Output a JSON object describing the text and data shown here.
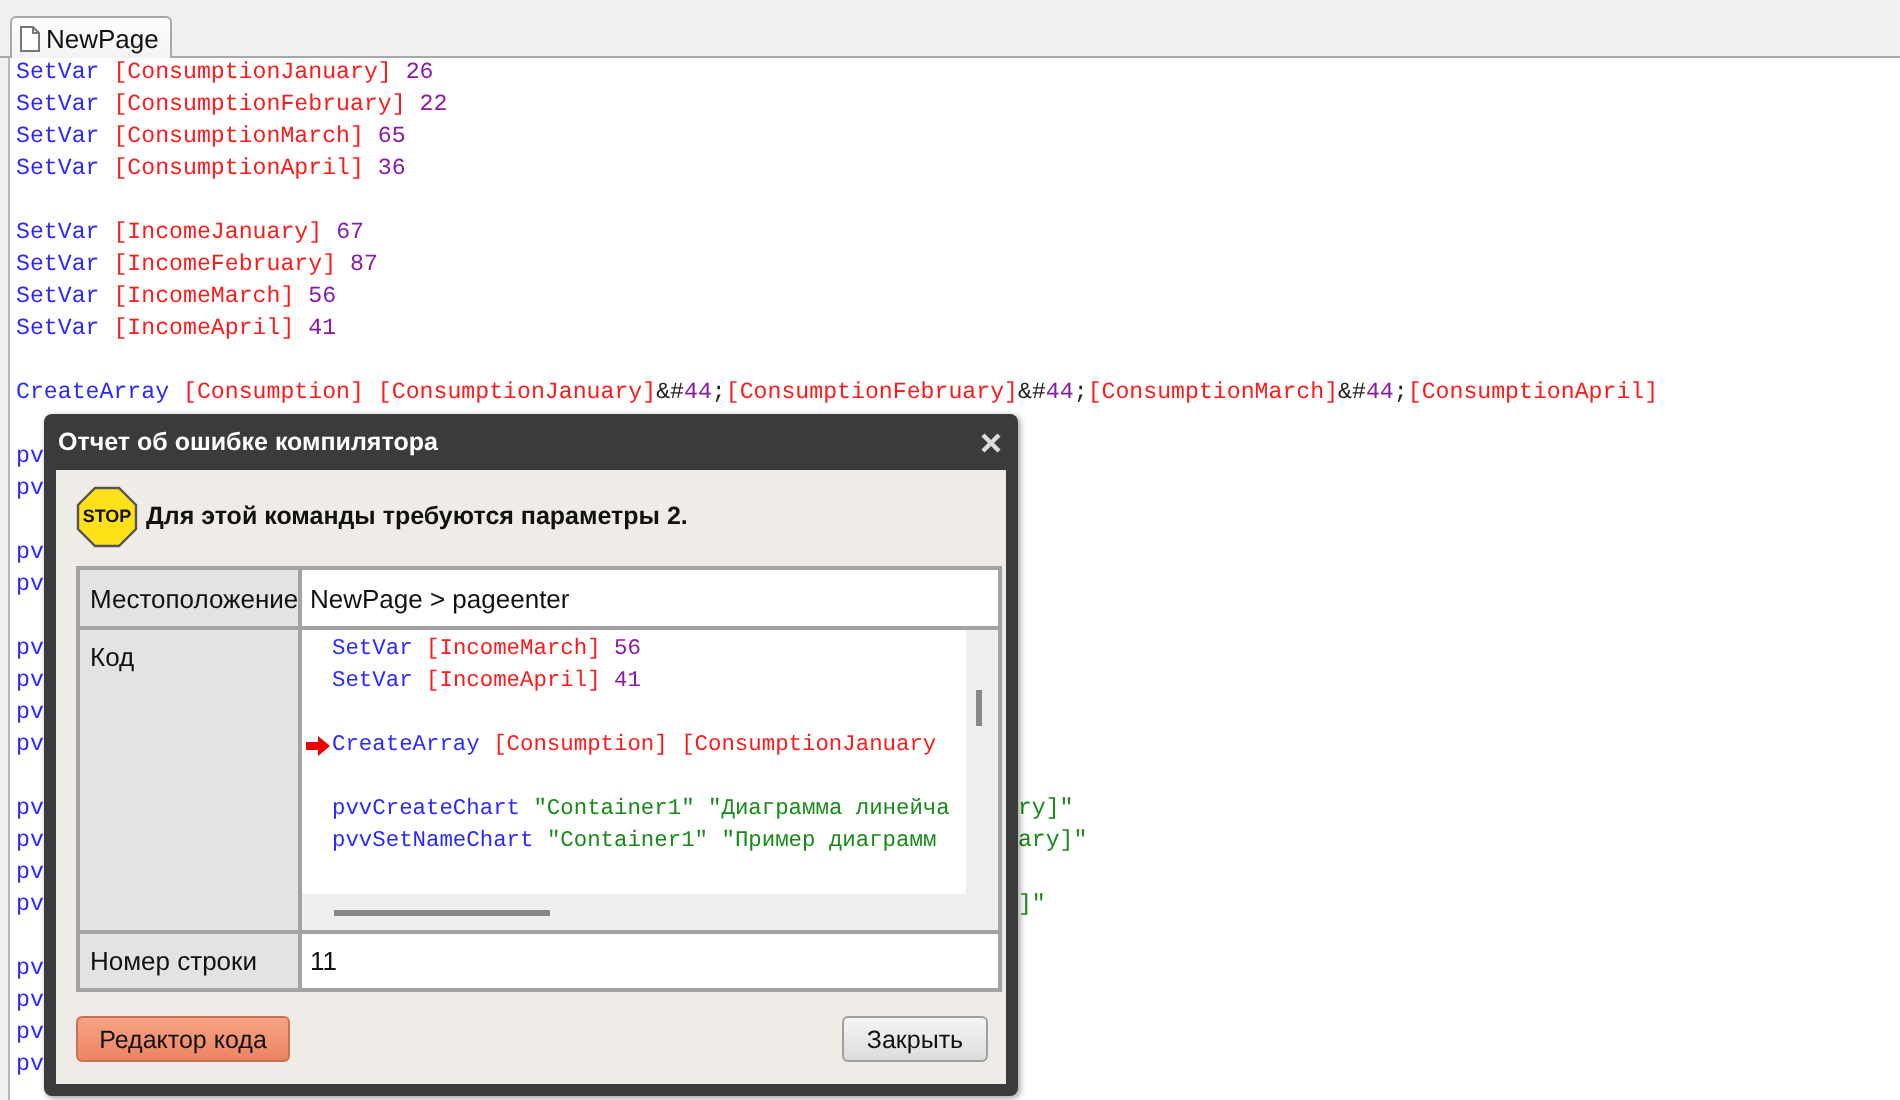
{
  "tab": {
    "label": "NewPage",
    "selected": true
  },
  "editor": {
    "lines": [
      {
        "kind": "code",
        "tokens": [
          {
            "kind": "keyword",
            "text": "SetVar"
          },
          {
            "kind": "var",
            "text": "[ConsumptionJanuary]"
          },
          {
            "kind": "number",
            "text": "26"
          }
        ]
      },
      {
        "kind": "code",
        "tokens": [
          {
            "kind": "keyword",
            "text": "SetVar"
          },
          {
            "kind": "var",
            "text": "[ConsumptionFebruary]"
          },
          {
            "kind": "number",
            "text": "22"
          }
        ]
      },
      {
        "kind": "code",
        "tokens": [
          {
            "kind": "keyword",
            "text": "SetVar"
          },
          {
            "kind": "var",
            "text": "[ConsumptionMarch]"
          },
          {
            "kind": "number",
            "text": "65"
          }
        ]
      },
      {
        "kind": "code",
        "tokens": [
          {
            "kind": "keyword",
            "text": "SetVar"
          },
          {
            "kind": "var",
            "text": "[ConsumptionApril]"
          },
          {
            "kind": "number",
            "text": "36"
          }
        ]
      },
      {
        "kind": "blank"
      },
      {
        "kind": "code",
        "tokens": [
          {
            "kind": "keyword",
            "text": "SetVar"
          },
          {
            "kind": "var",
            "text": "[IncomeJanuary]"
          },
          {
            "kind": "number",
            "text": "67"
          }
        ]
      },
      {
        "kind": "code",
        "tokens": [
          {
            "kind": "keyword",
            "text": "SetVar"
          },
          {
            "kind": "var",
            "text": "[IncomeFebruary]"
          },
          {
            "kind": "number",
            "text": "87"
          }
        ]
      },
      {
        "kind": "code",
        "tokens": [
          {
            "kind": "keyword",
            "text": "SetVar"
          },
          {
            "kind": "var",
            "text": "[IncomeMarch]"
          },
          {
            "kind": "number",
            "text": "56"
          }
        ]
      },
      {
        "kind": "code",
        "tokens": [
          {
            "kind": "keyword",
            "text": "SetVar"
          },
          {
            "kind": "var",
            "text": "[IncomeApril]"
          },
          {
            "kind": "number",
            "text": "41"
          }
        ]
      },
      {
        "kind": "blank"
      },
      {
        "kind": "code",
        "tokens": [
          {
            "kind": "keyword",
            "text": "CreateArray"
          },
          {
            "kind": "var",
            "text": "[Consumption]"
          },
          {
            "kind": "group",
            "parts": [
              {
                "kind": "var",
                "text": "[ConsumptionJanuary]"
              },
              {
                "kind": "plain",
                "text": "&#"
              },
              {
                "kind": "number",
                "text": "44"
              },
              {
                "kind": "plain",
                "text": ";"
              },
              {
                "kind": "var",
                "text": "[ConsumptionFebruary]"
              },
              {
                "kind": "plain",
                "text": "&#"
              },
              {
                "kind": "number",
                "text": "44"
              },
              {
                "kind": "plain",
                "text": ";"
              },
              {
                "kind": "var",
                "text": "[ConsumptionMarch]"
              },
              {
                "kind": "plain",
                "text": "&#"
              },
              {
                "kind": "number",
                "text": "44"
              },
              {
                "kind": "plain",
                "text": ";"
              },
              {
                "kind": "var",
                "text": "[ConsumptionApril]"
              }
            ]
          }
        ]
      },
      {
        "kind": "blank"
      },
      {
        "kind": "covered",
        "tokens": [
          {
            "kind": "keyword",
            "text": "pv"
          }
        ]
      },
      {
        "kind": "covered",
        "tokens": [
          {
            "kind": "keyword",
            "text": "pv"
          }
        ]
      },
      {
        "kind": "blank"
      },
      {
        "kind": "covered",
        "tokens": [
          {
            "kind": "keyword",
            "text": "pv"
          }
        ]
      },
      {
        "kind": "covered",
        "tokens": [
          {
            "kind": "keyword",
            "text": "pv"
          }
        ]
      },
      {
        "kind": "blank"
      },
      {
        "kind": "covered",
        "tokens": [
          {
            "kind": "keyword",
            "text": "pv"
          }
        ]
      },
      {
        "kind": "covered",
        "tokens": [
          {
            "kind": "keyword",
            "text": "pv"
          }
        ]
      },
      {
        "kind": "covered",
        "tokens": [
          {
            "kind": "keyword",
            "text": "pv"
          }
        ]
      },
      {
        "kind": "covered",
        "tokens": [
          {
            "kind": "keyword",
            "text": "pv"
          }
        ]
      },
      {
        "kind": "blank"
      },
      {
        "kind": "covered",
        "tokens": [
          {
            "kind": "keyword",
            "text": "pv"
          }
        ],
        "right_tokens": [
          {
            "kind": "string",
            "text": "ry]\""
          }
        ]
      },
      {
        "kind": "covered",
        "tokens": [
          {
            "kind": "keyword",
            "text": "pv"
          }
        ],
        "right_tokens": [
          {
            "kind": "string",
            "text": "ary]\""
          }
        ]
      },
      {
        "kind": "covered",
        "tokens": [
          {
            "kind": "keyword",
            "text": "pv"
          }
        ]
      },
      {
        "kind": "covered",
        "tokens": [
          {
            "kind": "keyword",
            "text": "pv"
          }
        ],
        "right_tokens": [
          {
            "kind": "string",
            "text": "]\""
          }
        ]
      },
      {
        "kind": "blank"
      },
      {
        "kind": "covered",
        "tokens": [
          {
            "kind": "keyword",
            "text": "pv"
          }
        ]
      },
      {
        "kind": "covered",
        "tokens": [
          {
            "kind": "keyword",
            "text": "pv"
          }
        ]
      },
      {
        "kind": "covered",
        "tokens": [
          {
            "kind": "keyword",
            "text": "pv"
          }
        ]
      },
      {
        "kind": "covered",
        "tokens": [
          {
            "kind": "keyword",
            "text": "pv"
          }
        ]
      }
    ]
  },
  "dialog": {
    "title": "Отчет об ошибке компилятора",
    "stop_sign": "STOP",
    "message": "Для этой команды требуются параметры 2.",
    "fields": [
      {
        "kind": "text",
        "label": "Местоположение",
        "value": "NewPage > pageenter"
      },
      {
        "kind": "code",
        "label": "Код",
        "lines": [
          {
            "kind": "code",
            "current": false,
            "tokens": [
              {
                "kind": "keyword",
                "text": "SetVar"
              },
              {
                "kind": "var",
                "text": "[IncomeMarch]"
              },
              {
                "kind": "number",
                "text": "56"
              }
            ]
          },
          {
            "kind": "code",
            "current": false,
            "tokens": [
              {
                "kind": "keyword",
                "text": "SetVar"
              },
              {
                "kind": "var",
                "text": "[IncomeApril]"
              },
              {
                "kind": "number",
                "text": "41"
              }
            ]
          },
          {
            "kind": "blank"
          },
          {
            "kind": "code",
            "current": true,
            "tokens": [
              {
                "kind": "keyword",
                "text": "CreateArray"
              },
              {
                "kind": "var",
                "text": "[Consumption]"
              },
              {
                "kind": "var",
                "text": "[ConsumptionJanuary"
              }
            ]
          },
          {
            "kind": "blank"
          },
          {
            "kind": "code",
            "current": false,
            "tokens": [
              {
                "kind": "keyword",
                "text": "pvvCreateChart"
              },
              {
                "kind": "string",
                "text": "\"Container1\""
              },
              {
                "kind": "string",
                "text": "\"Диаграмма линейча"
              }
            ]
          },
          {
            "kind": "code",
            "current": false,
            "tokens": [
              {
                "kind": "keyword",
                "text": "pvvSetNameChart"
              },
              {
                "kind": "string",
                "text": "\"Container1\""
              },
              {
                "kind": "string",
                "text": "\"Пример диаграмм"
              }
            ]
          }
        ]
      },
      {
        "kind": "text",
        "label": "Номер строки",
        "value": "11"
      }
    ],
    "buttons": [
      {
        "kind": "primary",
        "label": "Редактор кода"
      },
      {
        "kind": "default",
        "label": "Закрыть"
      }
    ]
  }
}
